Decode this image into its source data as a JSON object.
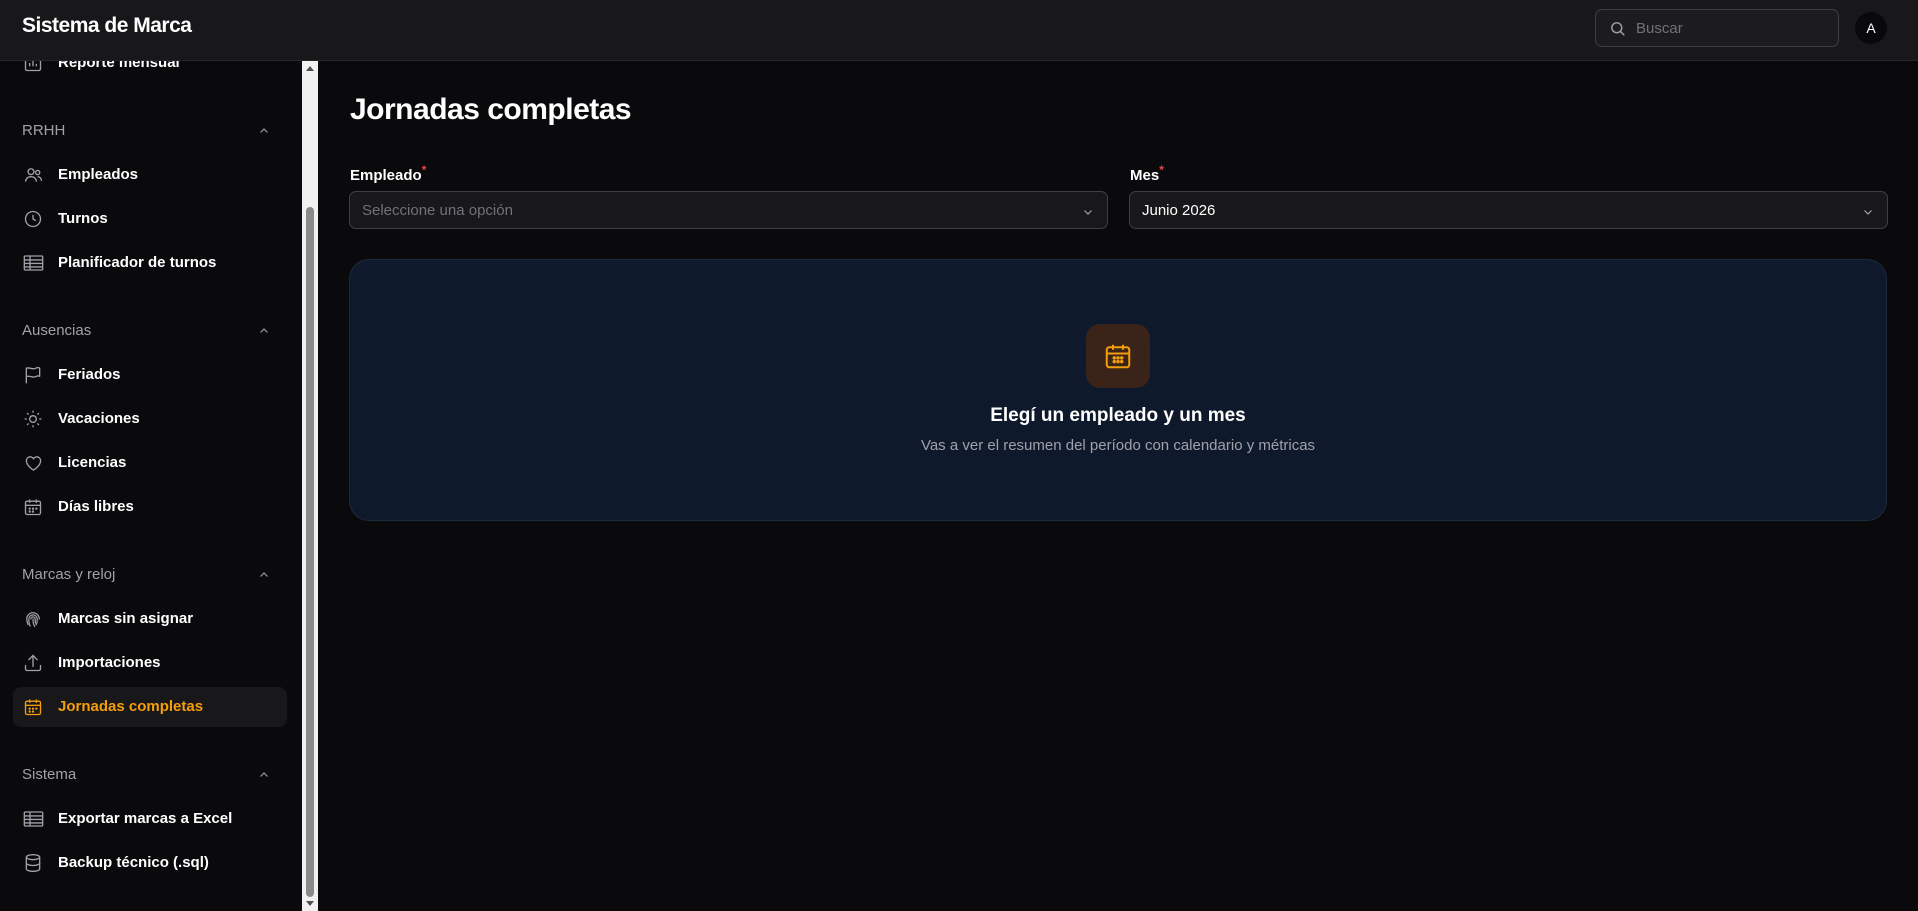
{
  "app": {
    "title": "Sistema de Marca"
  },
  "topbar": {
    "search_placeholder": "Buscar",
    "avatar_initial": "A"
  },
  "sidebar": {
    "partial_item": {
      "label": "Reporte mensual",
      "icon": "chart-icon"
    },
    "groups": [
      {
        "label": "RRHH",
        "items": [
          {
            "label": "Empleados",
            "icon": "users-icon"
          },
          {
            "label": "Turnos",
            "icon": "clock-icon"
          },
          {
            "label": "Planificador de turnos",
            "icon": "table-icon"
          }
        ]
      },
      {
        "label": "Ausencias",
        "items": [
          {
            "label": "Feriados",
            "icon": "flag-icon"
          },
          {
            "label": "Vacaciones",
            "icon": "sun-icon"
          },
          {
            "label": "Licencias",
            "icon": "heart-icon"
          },
          {
            "label": "Días libres",
            "icon": "calendar-icon"
          }
        ]
      },
      {
        "label": "Marcas y reloj",
        "items": [
          {
            "label": "Marcas sin asignar",
            "icon": "fingerprint-icon"
          },
          {
            "label": "Importaciones",
            "icon": "upload-icon"
          },
          {
            "label": "Jornadas completas",
            "icon": "calendar-icon",
            "active": true
          }
        ]
      },
      {
        "label": "Sistema",
        "items": [
          {
            "label": "Exportar marcas a Excel",
            "icon": "table-icon"
          },
          {
            "label": "Backup técnico (.sql)",
            "icon": "database-icon"
          }
        ]
      }
    ]
  },
  "main": {
    "title": "Jornadas completas",
    "employee": {
      "label": "Empleado",
      "placeholder": "Seleccione una opción"
    },
    "month": {
      "label": "Mes",
      "value": "Junio 2026"
    },
    "empty_state": {
      "title": "Elegí un empleado y un mes",
      "subtitle": "Vas a ver el resumen del período con calendario y métricas",
      "icon": "calendar-icon"
    }
  },
  "colors": {
    "accent": "#f59e0b",
    "background": "#0a0a0c",
    "topbar": "#18181b",
    "card": "#0f192c",
    "required": "#ef4444"
  }
}
